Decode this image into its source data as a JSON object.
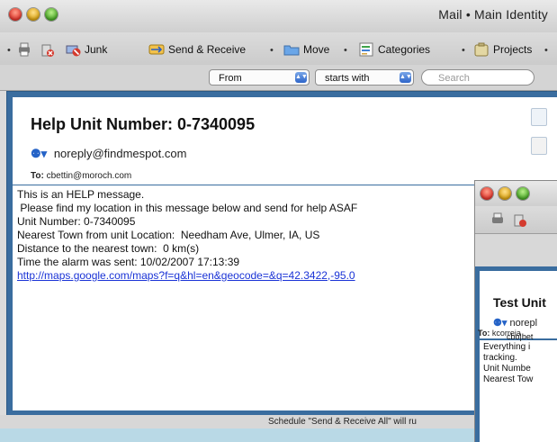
{
  "main_window": {
    "title": "Mail • Main Identity",
    "toolbar": {
      "junk": "Junk",
      "send_receive": "Send & Receive",
      "move": "Move",
      "categories": "Categories",
      "projects": "Projects"
    },
    "filter": {
      "field": "From",
      "operator": "starts with",
      "search_placeholder": "Search"
    },
    "message": {
      "subject": "Help Unit Number: 0-7340095",
      "from": "noreply@findmespot.com",
      "to_label": "To:",
      "to": "cbettin@moroch.com",
      "body_lines": [
        "This is an HELP message.",
        " Please find my location in this message below and send for help ASAF",
        "Unit Number: 0-7340095",
        "Nearest Town from unit Location:  Needham Ave, Ulmer, IA, US",
        "Distance to the nearest town:  0 km(s)",
        "Time the alarm was sent: 10/02/2007 17:13:39"
      ],
      "link": "http://maps.google.com/maps?f=q&hl=en&geocode=&q=42.3422,-95.0"
    },
    "status": "Schedule \"Send & Receive All\" will ru"
  },
  "second_window": {
    "subject": "Test Unit",
    "from": "norepl",
    "to_label": "To:",
    "to_line1": "kcorreia",
    "to_line2": "cbo|bet",
    "body_lines": [
      "Everything i",
      "tracking.",
      "Unit Numbe",
      "Nearest Tow"
    ]
  },
  "colors": {
    "pane_blue": "#3a6d9f",
    "link": "#1a33d6",
    "backdrop": "#b9d9e6"
  }
}
